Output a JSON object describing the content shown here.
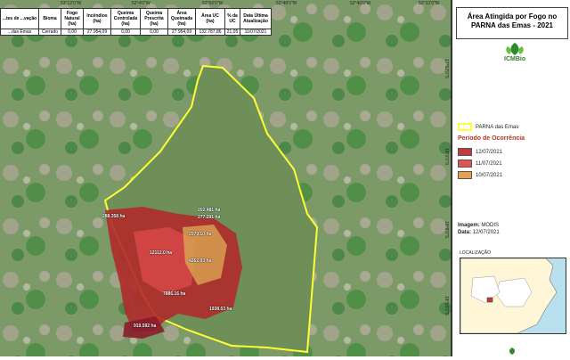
{
  "map": {
    "coords_top": [
      "53°12'0\"W",
      "52°4'0\"W",
      "52°56'0\"W",
      "52°48'0\"W",
      "52°40'0\"W",
      "52°32'0\"W"
    ],
    "coords_right": [
      "17°52'0\"S",
      "18°0'0\"S",
      "18°8'0\"S",
      "18°16'0\"S"
    ],
    "area_labels": [
      "288.358 ha",
      "202.481 ha",
      "277.291 ha",
      "2579.10 ha",
      "12112.0 ha",
      "4262.93 ha",
      "7886.16 ha",
      "1938.53 ha",
      "919.592 ha"
    ]
  },
  "stats_table": {
    "headers": [
      "...tes de ...vação",
      "Bioma",
      "Fogo Natural (ha)",
      "Incêndios (ha)",
      "Queima Controlada (ha)",
      "Queima Prescrita (ha)",
      "Área Queimada (ha)",
      "Área UC (ha)",
      "% da UC",
      "Data Última Atualização"
    ],
    "row": [
      "...das Emas",
      "Cerrado",
      "0,00",
      "27.954,09",
      "0,00",
      "0,00",
      "27.954,09",
      "132.787,86",
      "21,05",
      "11/07/2021"
    ]
  },
  "panel": {
    "title_line1": "Área Atingida por Fogo no",
    "title_line2": "PARNA das Emas - 2021",
    "logo_text": "ICMBio",
    "legend_park": "PARNA das Emas",
    "legend_title": "Período de Ocorrência",
    "legend_items": [
      {
        "label": "12/07/2021",
        "color": "#c23a3a"
      },
      {
        "label": "11/07/2021",
        "color": "#e05550"
      },
      {
        "label": "10/07/2021",
        "color": "#e8a050"
      }
    ],
    "park_color": "#ffff33",
    "image_label": "Imagem:",
    "image_value": "MODIS",
    "date_label": "Data:",
    "date_value": "12/07/2021",
    "location_label": "LOCALIZAÇÃO"
  }
}
